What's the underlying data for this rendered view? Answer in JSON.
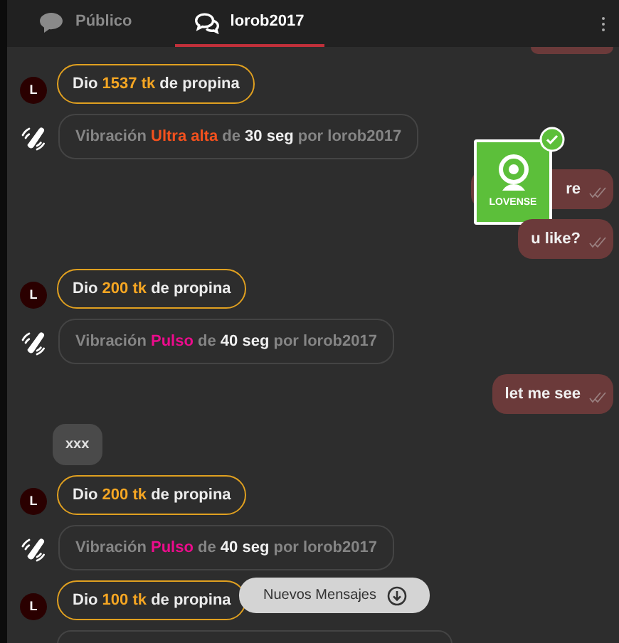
{
  "tabs": [
    {
      "label": "Público",
      "selected": false
    },
    {
      "label": "lorob2017",
      "selected": true
    }
  ],
  "messages": [
    {
      "kind": "tip",
      "avatar": "L",
      "prefix": "Dio",
      "amount": "1537 tk",
      "suffix": "de propina"
    },
    {
      "kind": "vibration",
      "prefix": "Vibración",
      "strength": "Ultra alta",
      "color": "#f4511e",
      "mid": "de",
      "duration": "30 seg",
      "by": "por lorob2017"
    },
    {
      "kind": "sent",
      "text": "re",
      "toy": {
        "label": "LOVENSE",
        "connected": true
      }
    },
    {
      "kind": "sent",
      "text": "u like?"
    },
    {
      "kind": "tip",
      "avatar": "L",
      "prefix": "Dio",
      "amount": "200 tk",
      "suffix": "de propina"
    },
    {
      "kind": "vibration",
      "prefix": "Vibración",
      "strength": "Pulso",
      "color": "#ec0c8c",
      "mid": "de",
      "duration": "40 seg",
      "by": "por lorob2017"
    },
    {
      "kind": "sent",
      "text": "let me see"
    },
    {
      "kind": "received",
      "text": "xxx"
    },
    {
      "kind": "tip",
      "avatar": "L",
      "prefix": "Dio",
      "amount": "200 tk",
      "suffix": "de propina"
    },
    {
      "kind": "vibration",
      "prefix": "Vibración",
      "strength": "Pulso",
      "color": "#ec0c8c",
      "mid": "de",
      "duration": "40 seg",
      "by": "por lorob2017"
    },
    {
      "kind": "tip",
      "avatar": "L",
      "prefix": "Dio",
      "amount": "100 tk",
      "suffix": "de propina"
    }
  ],
  "new_messages_button": {
    "label": "Nuevos Mensajes"
  }
}
